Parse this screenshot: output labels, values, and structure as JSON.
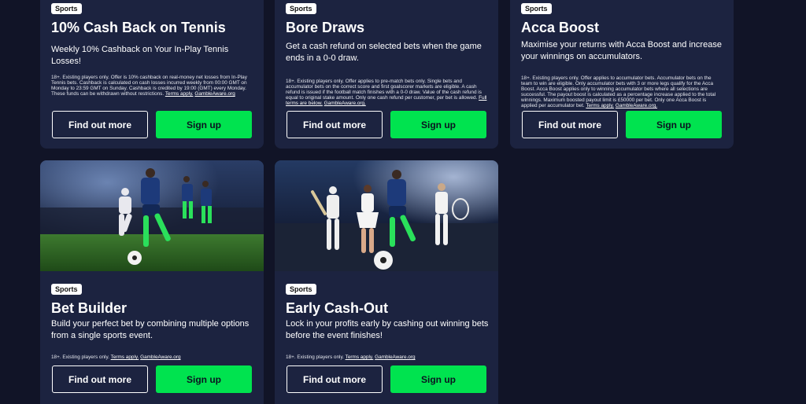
{
  "cards": [
    {
      "badge": "Sports",
      "title": "10% Cash Back on Tennis",
      "desc": "Weekly 10% Cashback on Your In-Play Tennis Losses!",
      "terms": "18+. Existing players only. Offer is 10% cashback on real-money net losses from In-Play Tennis bets. Cashback is calculated on cash losses incurred weekly from 00:00 GMT on Monday to 23:59 GMT on Sunday. Cashback is credited by 19:00 (GMT) every Monday. These funds can be withdrawn without restrictions.",
      "terms_link": "Terms apply.",
      "gamble": "GambleAware.org",
      "find": "Find out more",
      "signup": "Sign up"
    },
    {
      "badge": "Sports",
      "title": "Bore Draws",
      "desc": "Get a cash refund on selected bets when the game ends in a 0-0 draw.",
      "terms": "18+. Existing players only. Offer applies to pre-match bets only. Single bets and accumulator bets on the correct score and first goalscorer markets are eligible. A cash refund is issued if the football match finishes with a 0-0 draw. Value of the cash refund is equal to original stake amount. Only one cash refund per customer, per bet is allowed.",
      "terms_link": "Full terms are below.",
      "gamble": "GambleAware.org.",
      "find": "Find out more",
      "signup": "Sign up"
    },
    {
      "badge": "Sports",
      "title": "Acca Boost",
      "desc": "Maximise your returns with Acca Boost and increase your winnings on accumulators.",
      "terms": "18+. Existing players only. Offer applies to accumulator bets. Accumulator bets on the team to win are eligible. Only accumulator bets with 3 or more legs qualify for the Acca Boost. Acca Boost applies only to winning accumulator bets where all selections are successful. The payout boost is calculated as a percentage increase applied to the total winnings. Maximum boosted payout limit is £50000 per bet. Only one Acca Boost is applied per accumulator bet.",
      "terms_link": "Terms apply.",
      "gamble": "GambleAware.org.",
      "find": "Find out more",
      "signup": "Sign up"
    },
    {
      "badge": "Sports",
      "title": "Bet Builder",
      "desc": "Build your perfect bet by combining multiple options from a single sports event.",
      "terms": "18+. Existing players only.",
      "terms_link": "Terms apply.",
      "gamble": "GambleAware.org",
      "find": "Find out more",
      "signup": "Sign up"
    },
    {
      "badge": "Sports",
      "title": "Early Cash-Out",
      "desc": "Lock in your profits early by cashing out winning bets before the event finishes!",
      "terms": "18+. Existing players only.",
      "terms_link": "Terms apply.",
      "gamble": "GambleAware.org",
      "find": "Find out more",
      "signup": "Sign up"
    }
  ]
}
